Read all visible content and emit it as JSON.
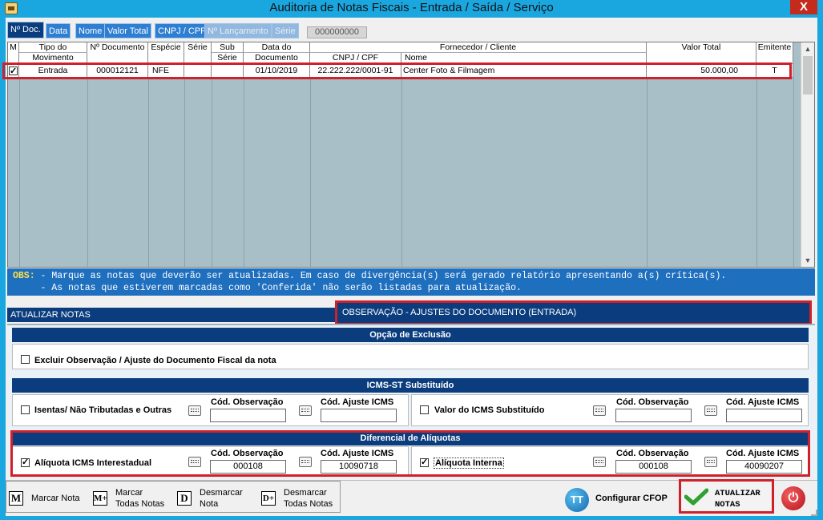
{
  "window": {
    "title": "Auditoria de Notas Fiscais   -   Entrada / Saída / Serviço",
    "close_glyph": "X"
  },
  "tabs": [
    {
      "label": "Nº Doc.",
      "state": "active"
    },
    {
      "label": "Data",
      "state": "normal"
    },
    {
      "label": "Nome",
      "state": "normal"
    },
    {
      "label": "Valor Total",
      "state": "normal"
    },
    {
      "label": "CNPJ / CPF",
      "state": "normal"
    },
    {
      "label": "Nº Lançamento",
      "state": "disabled"
    },
    {
      "label": "Série",
      "state": "disabled"
    }
  ],
  "search_value": "000000000",
  "grid": {
    "headers": {
      "m": "M",
      "tipo_top": "Tipo do",
      "tipo_bot": "Movimento",
      "ndoc": "Nº Documento",
      "especie": "Espécie",
      "serie": "Série",
      "sub_top": "Sub",
      "sub_bot": "Série",
      "data_top": "Data do",
      "data_bot": "Documento",
      "forn_top": "Fornecedor / Cliente",
      "cnpj": "CNPJ / CPF",
      "nome": "Nome",
      "valor": "Valor Total",
      "emitente": "Emitente"
    },
    "rows": [
      {
        "checked": true,
        "tipo": "Entrada",
        "ndoc": "000012121",
        "especie": "NFE",
        "serie": "",
        "sub_serie": "",
        "data": "01/10/2019",
        "cnpj": "22.222.222/0001-91",
        "nome": "Center Foto & Filmagem",
        "valor": "50.000,00",
        "emitente": "T"
      }
    ]
  },
  "obs": {
    "label": "OBS:",
    "line1": " - Marque as notas que deverão ser atualizadas. Em caso de divergência(s) será gerado relatório apresentando a(s) crítica(s).",
    "line2": "     - As notas que estiverem marcadas como 'Conferida' não serão listadas para atualização."
  },
  "sections": {
    "left_tab": "ATUALIZAR NOTAS",
    "right_tab": "OBSERVAÇÃO - AJUSTES DO DOCUMENTO (ENTRADA)"
  },
  "exclusao": {
    "title": "Opção de Exclusão",
    "option": "Excluir Observação / Ajuste do Documento Fiscal da nota",
    "checked": false
  },
  "icms_st": {
    "title": "ICMS-ST Substituído",
    "left": {
      "label": "Isentas/ Não Tributadas e Outras",
      "checked": false,
      "obs_label": "Cód. Observação",
      "obs_value": "",
      "ajuste_label": "Cód. Ajuste ICMS",
      "ajuste_value": ""
    },
    "right": {
      "label": "Valor do ICMS Substituído",
      "checked": false,
      "obs_label": "Cód. Observação",
      "obs_value": "",
      "ajuste_label": "Cód. Ajuste ICMS",
      "ajuste_value": ""
    }
  },
  "diferencial": {
    "title": "Diferencial de Alíquotas",
    "left": {
      "label": "Alíquota ICMS Interestadual",
      "checked": true,
      "obs_label": "Cód. Observação",
      "obs_value": "000108",
      "ajuste_label": "Cód. Ajuste ICMS",
      "ajuste_value": "10090718"
    },
    "right": {
      "label": "Alíquota Interna",
      "checked": true,
      "obs_label": "Cód. Observação",
      "obs_value": "000108",
      "ajuste_label": "Cód. Ajuste ICMS",
      "ajuste_value": "40090207"
    }
  },
  "toolbar": {
    "marcar_key": "M",
    "marcar": "Marcar Nota",
    "marcar_todas_key": "M+",
    "marcar_todas_1": "Marcar",
    "marcar_todas_2": "Todas Notas",
    "desmarcar_key": "D",
    "desmarcar_1": "Desmarcar",
    "desmarcar_2": "Nota",
    "desmarcar_todas_key": "D+",
    "desmarcar_todas_1": "Desmarcar",
    "desmarcar_todas_2": "Todas Notas",
    "cfop_glyph": "TT",
    "cfop": "Configurar CFOP",
    "atualizar_1": "ATUALIZAR",
    "atualizar_2": "NOTAS",
    "power_glyph": "⏻"
  }
}
